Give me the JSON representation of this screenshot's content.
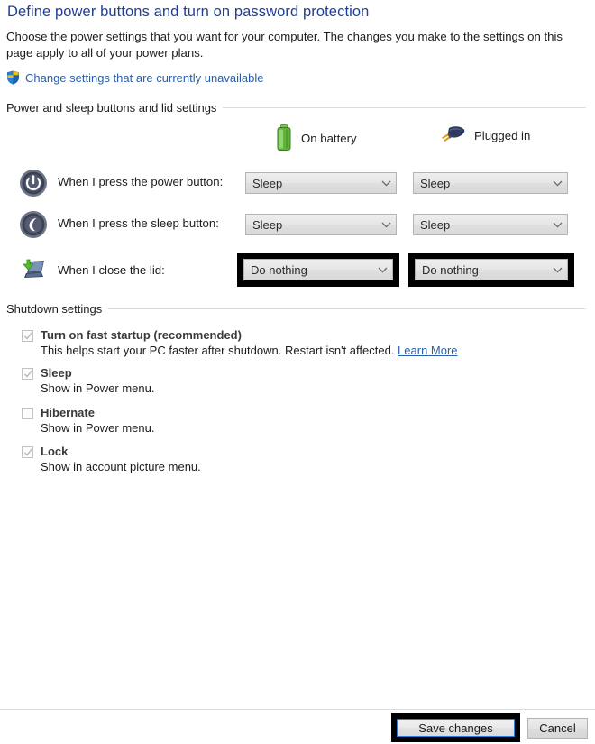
{
  "page": {
    "title": "Define power buttons and turn on password protection",
    "intro": "Choose the power settings that you want for your computer. The changes you make to the settings on this page apply to all of your power plans.",
    "uac_link": "Change settings that are currently unavailable",
    "shield_icon": "uac-shield-icon"
  },
  "sections": {
    "power_sleep_lid": {
      "label": "Power and sleep buttons and lid settings",
      "columns": [
        {
          "id": "battery",
          "label": "On battery",
          "icon": "battery-icon"
        },
        {
          "id": "plugged",
          "label": "Plugged in",
          "icon": "power-plug-icon"
        }
      ],
      "rows": [
        {
          "id": "power-button",
          "icon": "power-button-icon",
          "label": "When I press the power button:",
          "battery_value": "Sleep",
          "plugged_value": "Sleep",
          "highlighted": false
        },
        {
          "id": "sleep-button",
          "icon": "sleep-moon-icon",
          "label": "When I press the sleep button:",
          "battery_value": "Sleep",
          "plugged_value": "Sleep",
          "highlighted": false
        },
        {
          "id": "close-lid",
          "icon": "laptop-lid-icon",
          "label": "When I close the lid:",
          "battery_value": "Do nothing",
          "plugged_value": "Do nothing",
          "highlighted": true
        }
      ]
    },
    "shutdown": {
      "label": "Shutdown settings",
      "items": [
        {
          "id": "fast-startup",
          "label": "Turn on fast startup (recommended)",
          "checked": true,
          "description": "This helps start your PC faster after shutdown. Restart isn't affected.",
          "link": "Learn More"
        },
        {
          "id": "sleep",
          "label": "Sleep",
          "checked": true,
          "description": "Show in Power menu.",
          "link": ""
        },
        {
          "id": "hibernate",
          "label": "Hibernate",
          "checked": false,
          "description": "Show in Power menu.",
          "link": ""
        },
        {
          "id": "lock",
          "label": "Lock",
          "checked": true,
          "description": "Show in account picture menu.",
          "link": ""
        }
      ]
    }
  },
  "footer": {
    "save_label": "Save changes",
    "cancel_label": "Cancel",
    "save_highlighted": true
  },
  "colors": {
    "title_blue": "#1f3f93",
    "link_blue": "#2c5fa8",
    "annotation_black": "#000000",
    "focus_blue": "#2a7fd4",
    "battery_green": "#4caf32",
    "rule_gray": "#dcdcdc"
  }
}
